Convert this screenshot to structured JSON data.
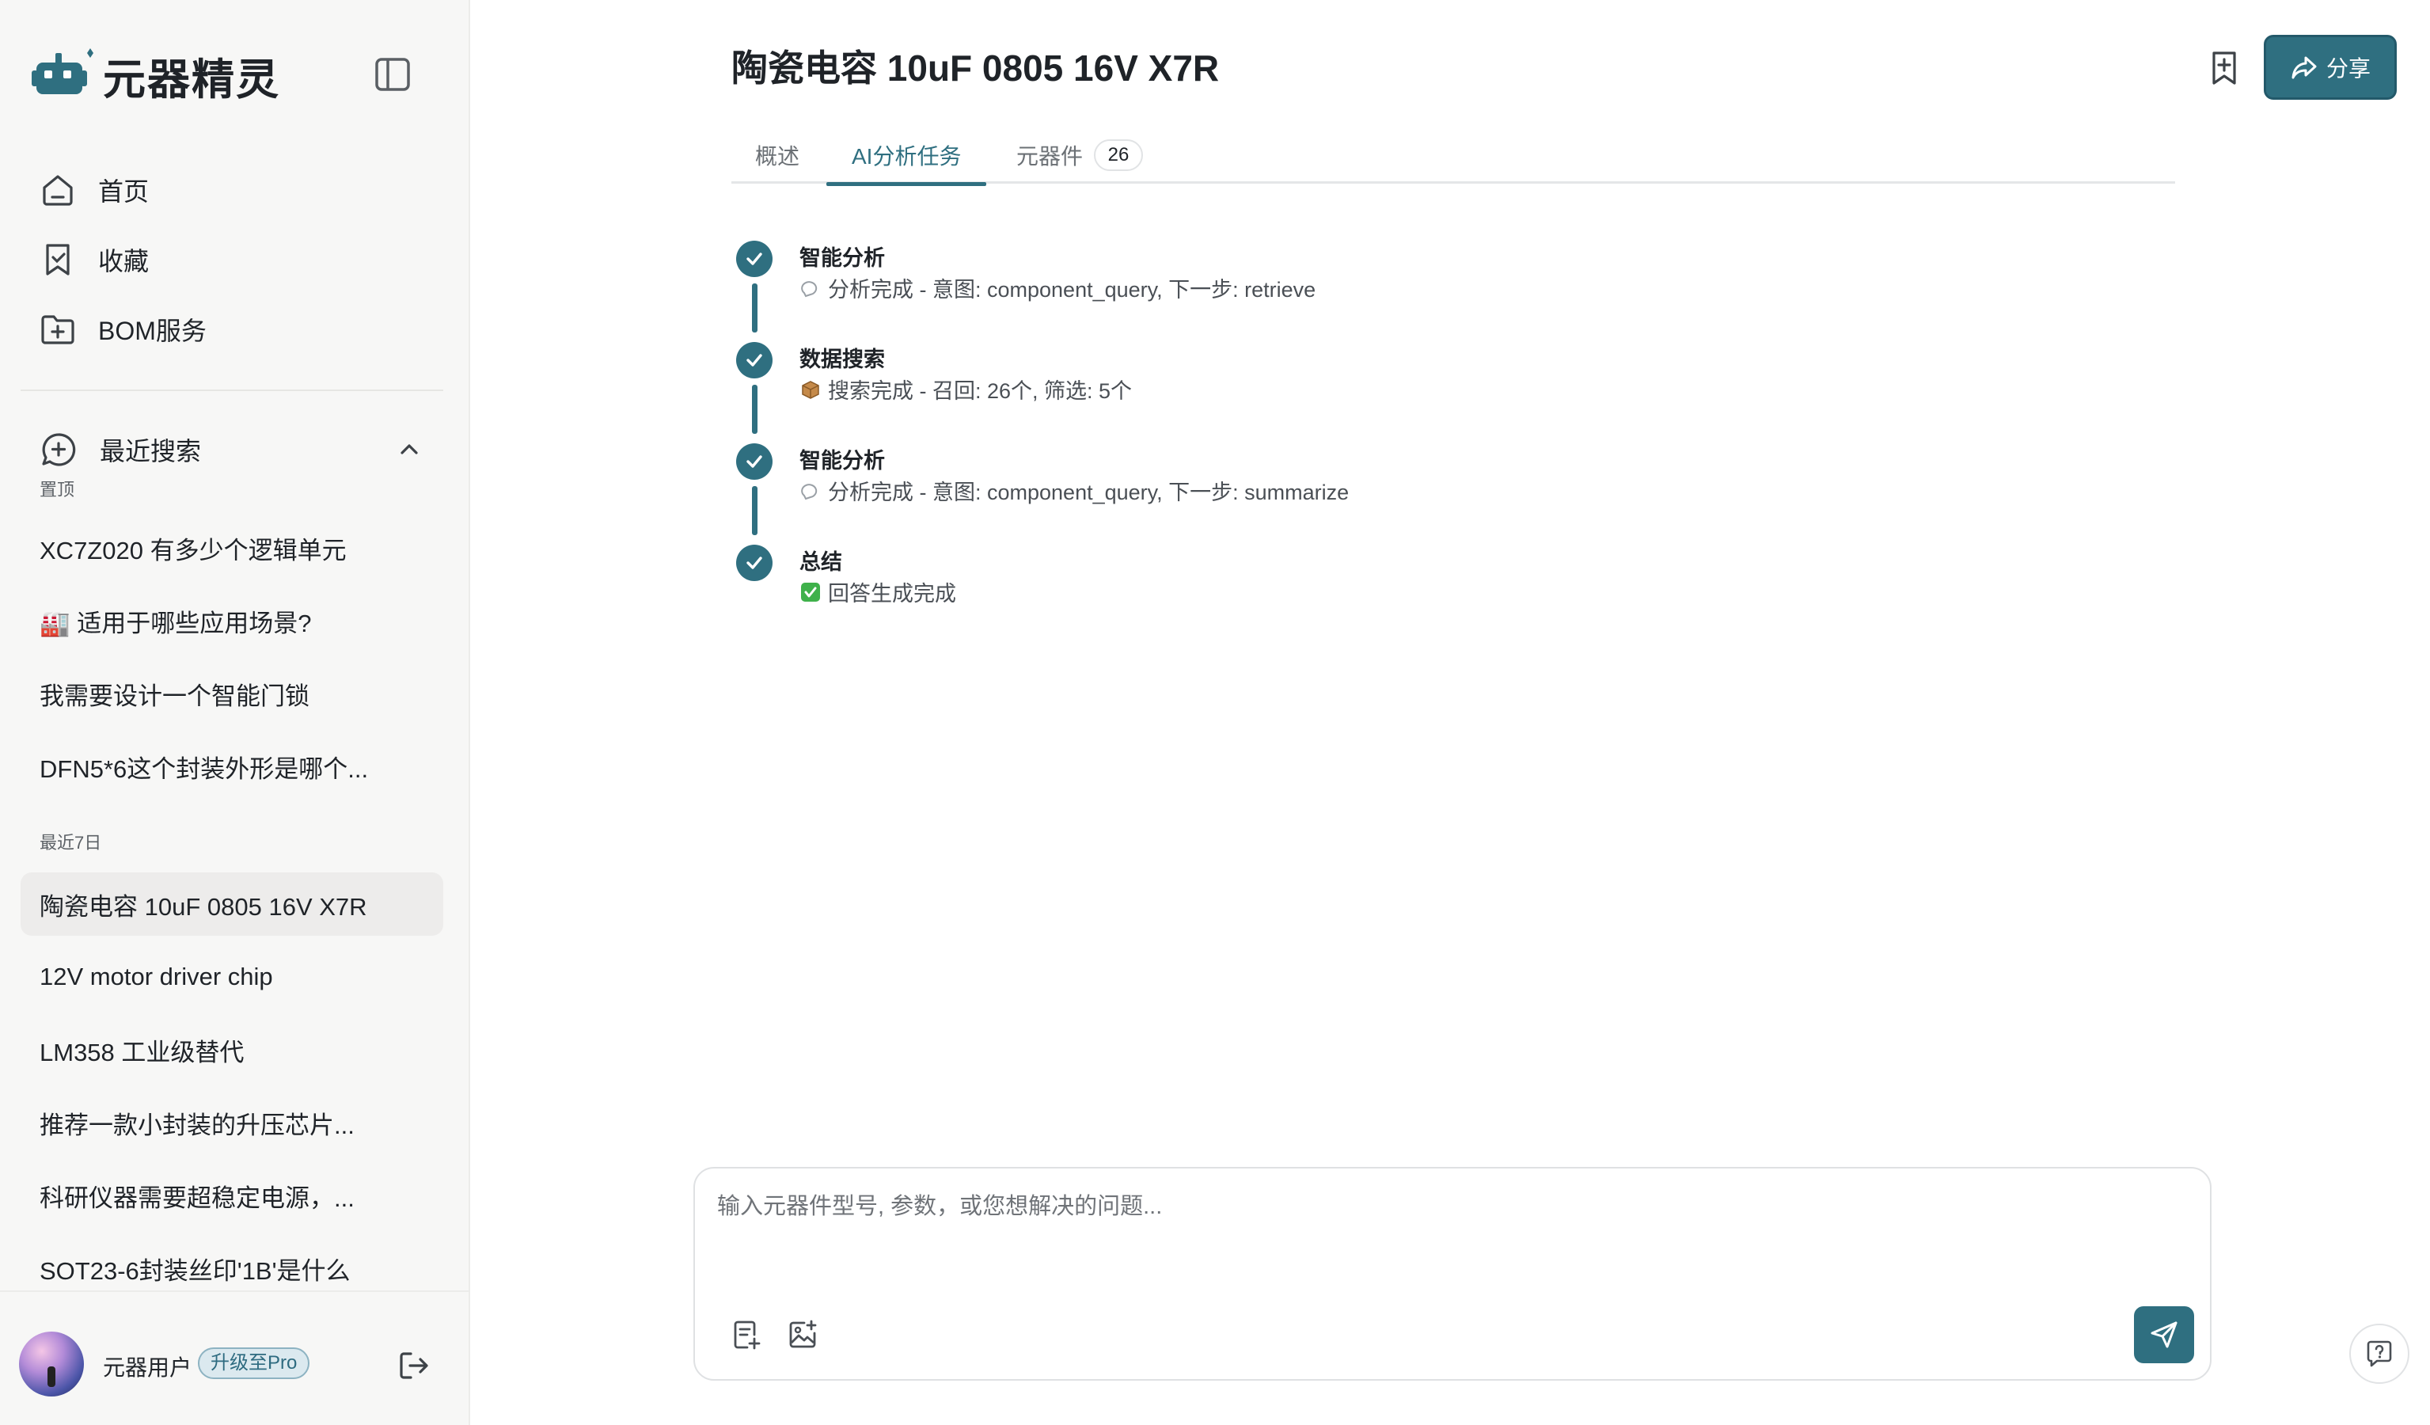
{
  "app": {
    "name": "元器精灵",
    "accent_color": "#2f6f80"
  },
  "sidebar": {
    "nav": [
      {
        "label": "首页",
        "icon": "home-icon"
      },
      {
        "label": "收藏",
        "icon": "bookmark-icon"
      },
      {
        "label": "BOM服务",
        "icon": "folder-plus-icon"
      }
    ],
    "recent": {
      "heading": "最近搜索",
      "pinned_label": "置顶",
      "pinned": [
        "XC7Z020 有多少个逻辑单元",
        "🏭 适用于哪些应用场景?",
        "我需要设计一个智能门锁",
        "DFN5*6这个封装外形是哪个..."
      ],
      "week_label": "最近7日",
      "week": [
        "陶瓷电容 10uF 0805 16V X7R",
        "12V motor driver chip",
        "LM358 工业级替代",
        "推荐一款小封装的升压芯片...",
        "科研仪器需要超稳定电源，...",
        "SOT23-6封装丝印'1B'是什么"
      ],
      "active_item": "陶瓷电容 10uF 0805 16V X7R"
    },
    "user": {
      "name": "元器用户",
      "badge": "升级至Pro"
    }
  },
  "main": {
    "title": "陶瓷电容 10uF 0805 16V X7R",
    "share_label": "分享",
    "tabs": [
      {
        "label": "概述"
      },
      {
        "label": "AI分析任务",
        "active": true
      },
      {
        "label": "元器件",
        "count": "26"
      }
    ],
    "steps": [
      {
        "title": "智能分析",
        "glyph": "thought-bubble-icon",
        "detail": "分析完成 - 意图: component_query, 下一步: retrieve"
      },
      {
        "title": "数据搜索",
        "glyph": "package-icon",
        "detail": "搜索完成 - 召回: 26个, 筛选: 5个"
      },
      {
        "title": "智能分析",
        "glyph": "thought-bubble-icon",
        "detail": "分析完成 - 意图: component_query, 下一步: summarize"
      },
      {
        "title": "总结",
        "glyph": "check-box-icon",
        "detail": "回答生成完成"
      }
    ],
    "composer": {
      "placeholder": "输入元器件型号, 参数，或您想解决的问题...",
      "value": ""
    }
  }
}
